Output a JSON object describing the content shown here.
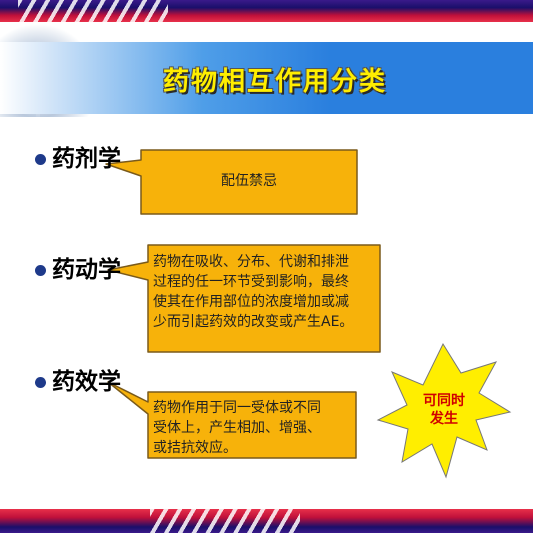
{
  "slide": {
    "title": "药物相互作用分类",
    "colors": {
      "title_text": "#ffee00",
      "callout_fill": "#f7b20a",
      "callout_border": "#7a5a1a",
      "burst_fill": "#ffee00",
      "burst_text": "#d00000",
      "bullet": "#1e3a8a"
    }
  },
  "items": [
    {
      "heading": "药剂学",
      "callout_lines": [
        "配伍禁忌"
      ]
    },
    {
      "heading": "药动学",
      "callout_lines": [
        "药物在吸收、分布、代谢和排泄",
        "过程的任一环节受到影响，最终",
        "使其在作用部位的浓度增加或减",
        "少而引起药效的改变或产生AE。"
      ]
    },
    {
      "heading": "药效学",
      "callout_lines": [
        "药物作用于同一受体或不同",
        "受体上，产生相加、增强、",
        "或拮抗效应。"
      ]
    }
  ],
  "burst": {
    "lines": [
      "可同时",
      "发生"
    ]
  }
}
